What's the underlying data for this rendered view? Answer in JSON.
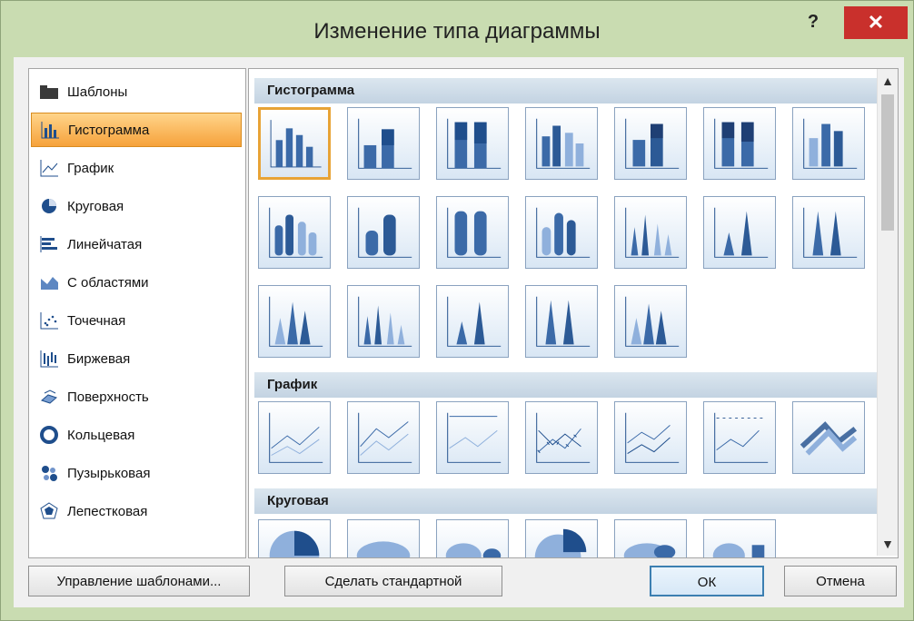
{
  "window": {
    "title": "Изменение типа диаграммы"
  },
  "titlebar": {
    "help_label": "?",
    "close_label": "✕"
  },
  "categories": [
    {
      "label": "Шаблоны",
      "icon": "folder-icon"
    },
    {
      "label": "Гистограмма",
      "icon": "bar-chart-icon",
      "selected": true
    },
    {
      "label": "График",
      "icon": "line-chart-icon"
    },
    {
      "label": "Круговая",
      "icon": "pie-chart-icon"
    },
    {
      "label": "Линейчатая",
      "icon": "horizontal-bar-icon"
    },
    {
      "label": "С областями",
      "icon": "area-chart-icon"
    },
    {
      "label": "Точечная",
      "icon": "scatter-icon"
    },
    {
      "label": "Биржевая",
      "icon": "stock-chart-icon"
    },
    {
      "label": "Поверхность",
      "icon": "surface-chart-icon"
    },
    {
      "label": "Кольцевая",
      "icon": "donut-icon"
    },
    {
      "label": "Пузырьковая",
      "icon": "bubble-icon"
    },
    {
      "label": "Лепестковая",
      "icon": "radar-icon"
    }
  ],
  "sections": [
    {
      "label": "Гистограмма"
    },
    {
      "label": "График"
    },
    {
      "label": "Круговая"
    }
  ],
  "buttons": {
    "manage_templates": "Управление шаблонами...",
    "set_default": "Сделать стандартной",
    "ok": "ОК",
    "cancel": "Отмена"
  },
  "colors": {
    "accent_orange": "#f6a23b",
    "chart_blue": "#1f4e8c",
    "close_red": "#c9302c"
  }
}
